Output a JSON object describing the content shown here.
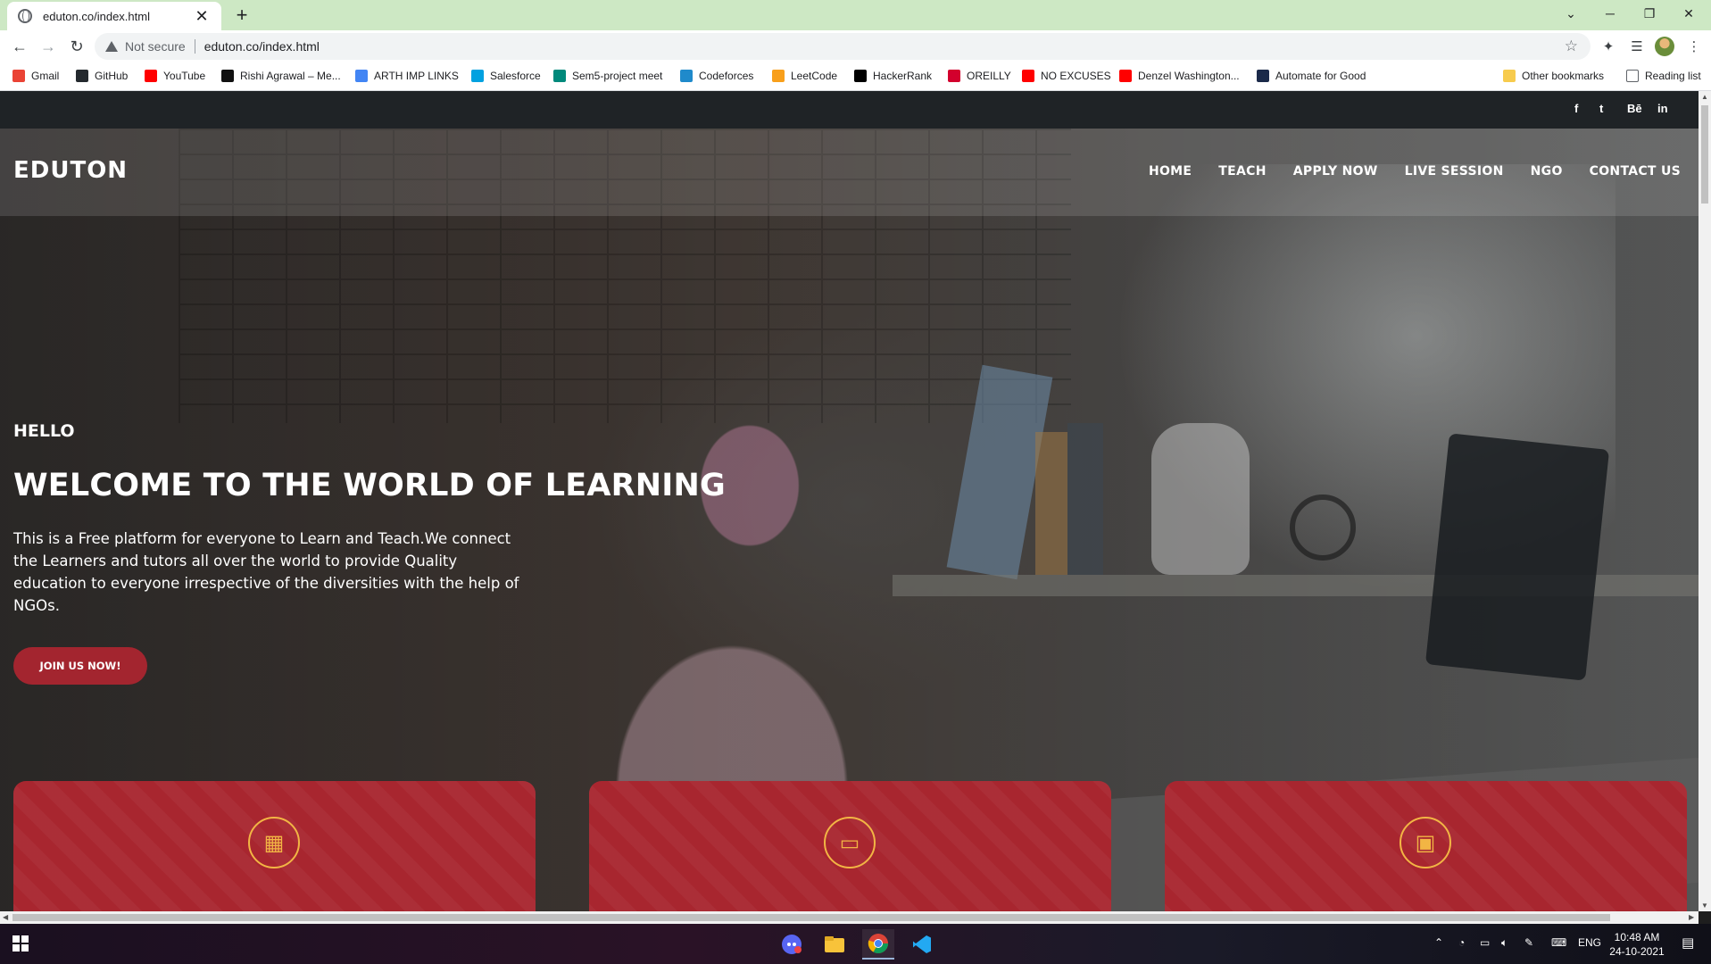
{
  "browser": {
    "tab_title": "eduton.co/index.html",
    "security_label": "Not secure",
    "url": "eduton.co/index.html"
  },
  "bookmarks": [
    {
      "label": "Gmail",
      "icon": "gmail-icon",
      "color": "#ea4335"
    },
    {
      "label": "GitHub",
      "icon": "github-icon",
      "color": "#24292e"
    },
    {
      "label": "YouTube",
      "icon": "youtube-icon",
      "color": "#ff0000"
    },
    {
      "label": "Rishi Agrawal – Me...",
      "icon": "medium-icon",
      "color": "#111111"
    },
    {
      "label": "ARTH IMP LINKS",
      "icon": "docs-icon",
      "color": "#4285f4"
    },
    {
      "label": "Salesforce",
      "icon": "salesforce-icon",
      "color": "#00a1e0"
    },
    {
      "label": "Sem5-project meet",
      "icon": "meet-icon",
      "color": "#00897b"
    },
    {
      "label": "Codeforces",
      "icon": "codeforces-icon",
      "color": "#1f8acb"
    },
    {
      "label": "LeetCode",
      "icon": "leetcode-icon",
      "color": "#f89f1b"
    },
    {
      "label": "HackerRank",
      "icon": "hackerrank-icon",
      "color": "#000000"
    },
    {
      "label": "OREILLY",
      "icon": "oreilly-icon",
      "color": "#d3002d"
    },
    {
      "label": "NO EXCUSES",
      "icon": "youtube-icon",
      "color": "#ff0000"
    },
    {
      "label": "Denzel Washington...",
      "icon": "youtube-icon",
      "color": "#ff0000"
    },
    {
      "label": "Automate for Good",
      "icon": "automate-icon",
      "color": "#1b2a4a"
    }
  ],
  "bookmarks_right": {
    "other": "Other bookmarks",
    "reading": "Reading list"
  },
  "social_icons": [
    "f",
    "t",
    "Bē",
    "in"
  ],
  "site": {
    "logo": "EDUTON",
    "nav": [
      "HOME",
      "TEACH",
      "APPLY NOW",
      "LIVE SESSION",
      "NGO",
      "CONTACT US"
    ],
    "hero": {
      "greeting": "HELLO",
      "headline": "WELCOME TO THE WORLD OF LEARNING",
      "description": "This is a Free platform for everyone to Learn and Teach.We connect the Learners and tutors all over the world to provide Quality education to everyone irrespective of the diversities with the help of NGOs.",
      "cta": "JOIN US NOW!"
    },
    "accent_color": "#a8262f"
  },
  "taskbar": {
    "lang": "ENG",
    "time": "10:48 AM",
    "date": "24-10-2021"
  }
}
